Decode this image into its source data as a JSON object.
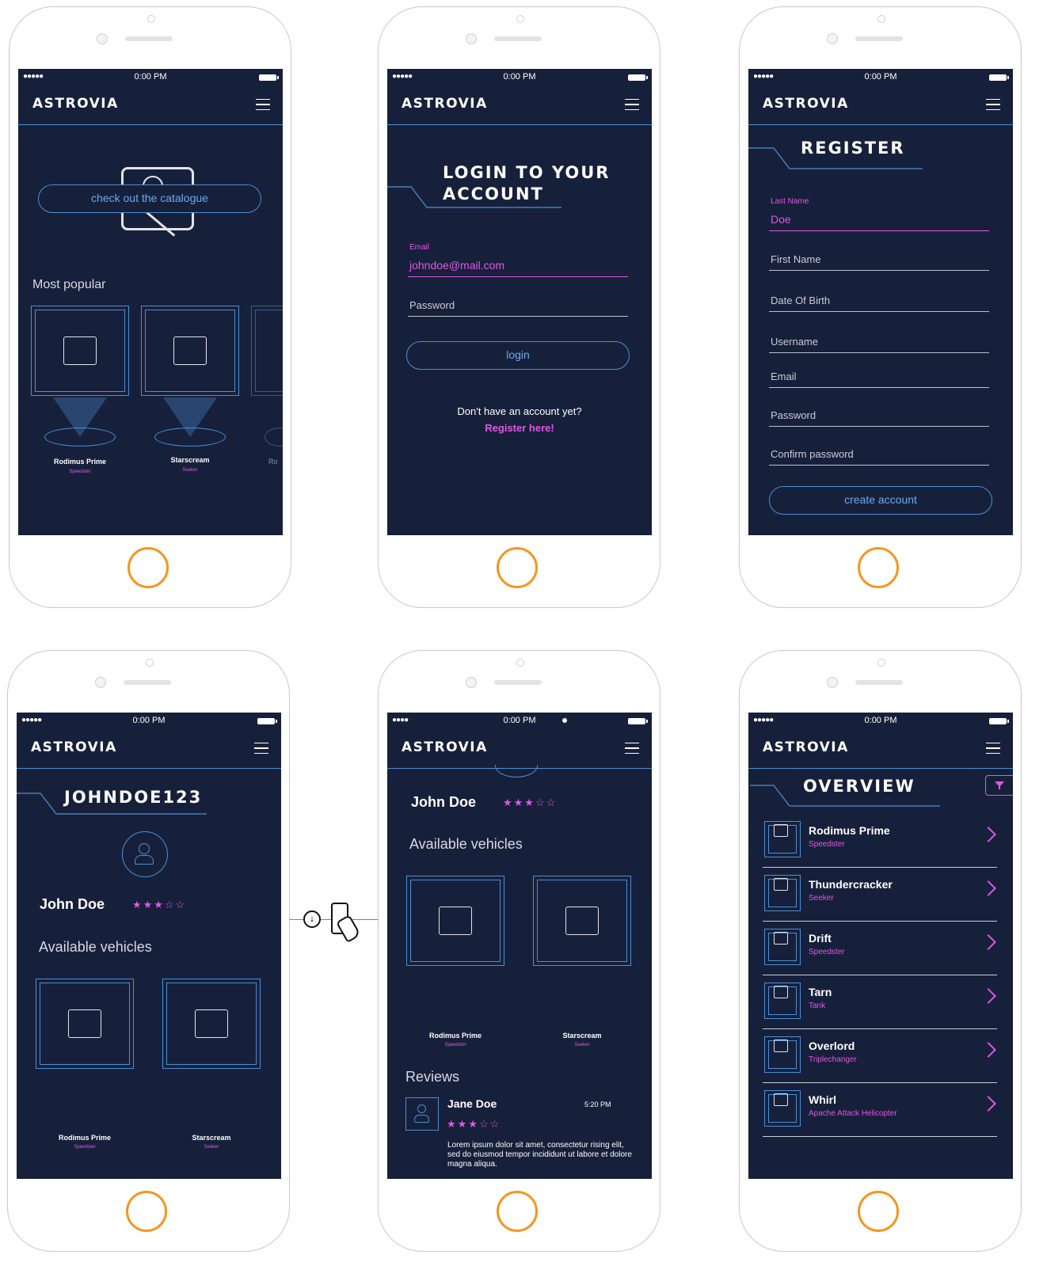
{
  "app": {
    "logo": "ASTROVIA",
    "time": "0:00 PM",
    "signal": "●●●●●"
  },
  "screen_home": {
    "cta": "check out the catalogue",
    "section": "Most popular",
    "items": [
      {
        "name": "Rodimus Prime",
        "type": "Speedster"
      },
      {
        "name": "Starscream",
        "type": "Seeker"
      },
      {
        "name": "Ro",
        "type": ""
      }
    ]
  },
  "screen_login": {
    "title_line1": "LOGIN TO YOUR",
    "title_line2": "ACCOUNT",
    "email_label": "Email",
    "email_value": "johndoe@mail.com",
    "password_label": "Password",
    "login_button": "login",
    "no_account": "Don't have an account yet?",
    "register_link": "Register here!"
  },
  "screen_register": {
    "title": "REGISTER",
    "last_name_label": "Last Name",
    "last_name_value": "Doe",
    "fields": [
      "First Name",
      "Date Of Birth",
      "Username",
      "Email",
      "Password",
      "Confirm password"
    ],
    "button": "create account"
  },
  "screen_profile": {
    "title": "JOHNDOE123",
    "name": "John Doe",
    "rating": "★★★☆☆",
    "section": "Available vehicles",
    "items": [
      {
        "name": "Rodimus Prime",
        "type": "Speedster"
      },
      {
        "name": "Starscream",
        "type": "Seeker"
      }
    ]
  },
  "screen_profile_scrolled": {
    "name": "John Doe",
    "rating": "★★★☆☆",
    "section": "Available vehicles",
    "items": [
      {
        "name": "Rodimus Prime",
        "type": "Speedster"
      },
      {
        "name": "Starscream",
        "type": "Seeker"
      }
    ],
    "reviews_title": "Reviews",
    "review": {
      "author": "Jane Doe",
      "time": "5:20 PM",
      "rating": "★★★☆☆",
      "text": "Lorem ipsum dolor sit amet, consectetur rising elit, sed do eiusmod tempor incididunt ut labore et dolore magna aliqua."
    }
  },
  "screen_overview": {
    "title": "OVERVIEW",
    "items": [
      {
        "name": "Rodimus Prime",
        "type": "Speedster"
      },
      {
        "name": "Thundercracker",
        "type": "Seeker"
      },
      {
        "name": "Drift",
        "type": "Speedster"
      },
      {
        "name": "Tarn",
        "type": "Tank"
      },
      {
        "name": "Overlord",
        "type": "Triplechanger"
      },
      {
        "name": "Whirl",
        "type": "Apache Attack Helicopter"
      }
    ]
  },
  "colors": {
    "screen_bg": "#17203a",
    "accent_blue": "#4a8fd6",
    "accent_pink": "#e056e6",
    "home_button": "#f7941d"
  }
}
